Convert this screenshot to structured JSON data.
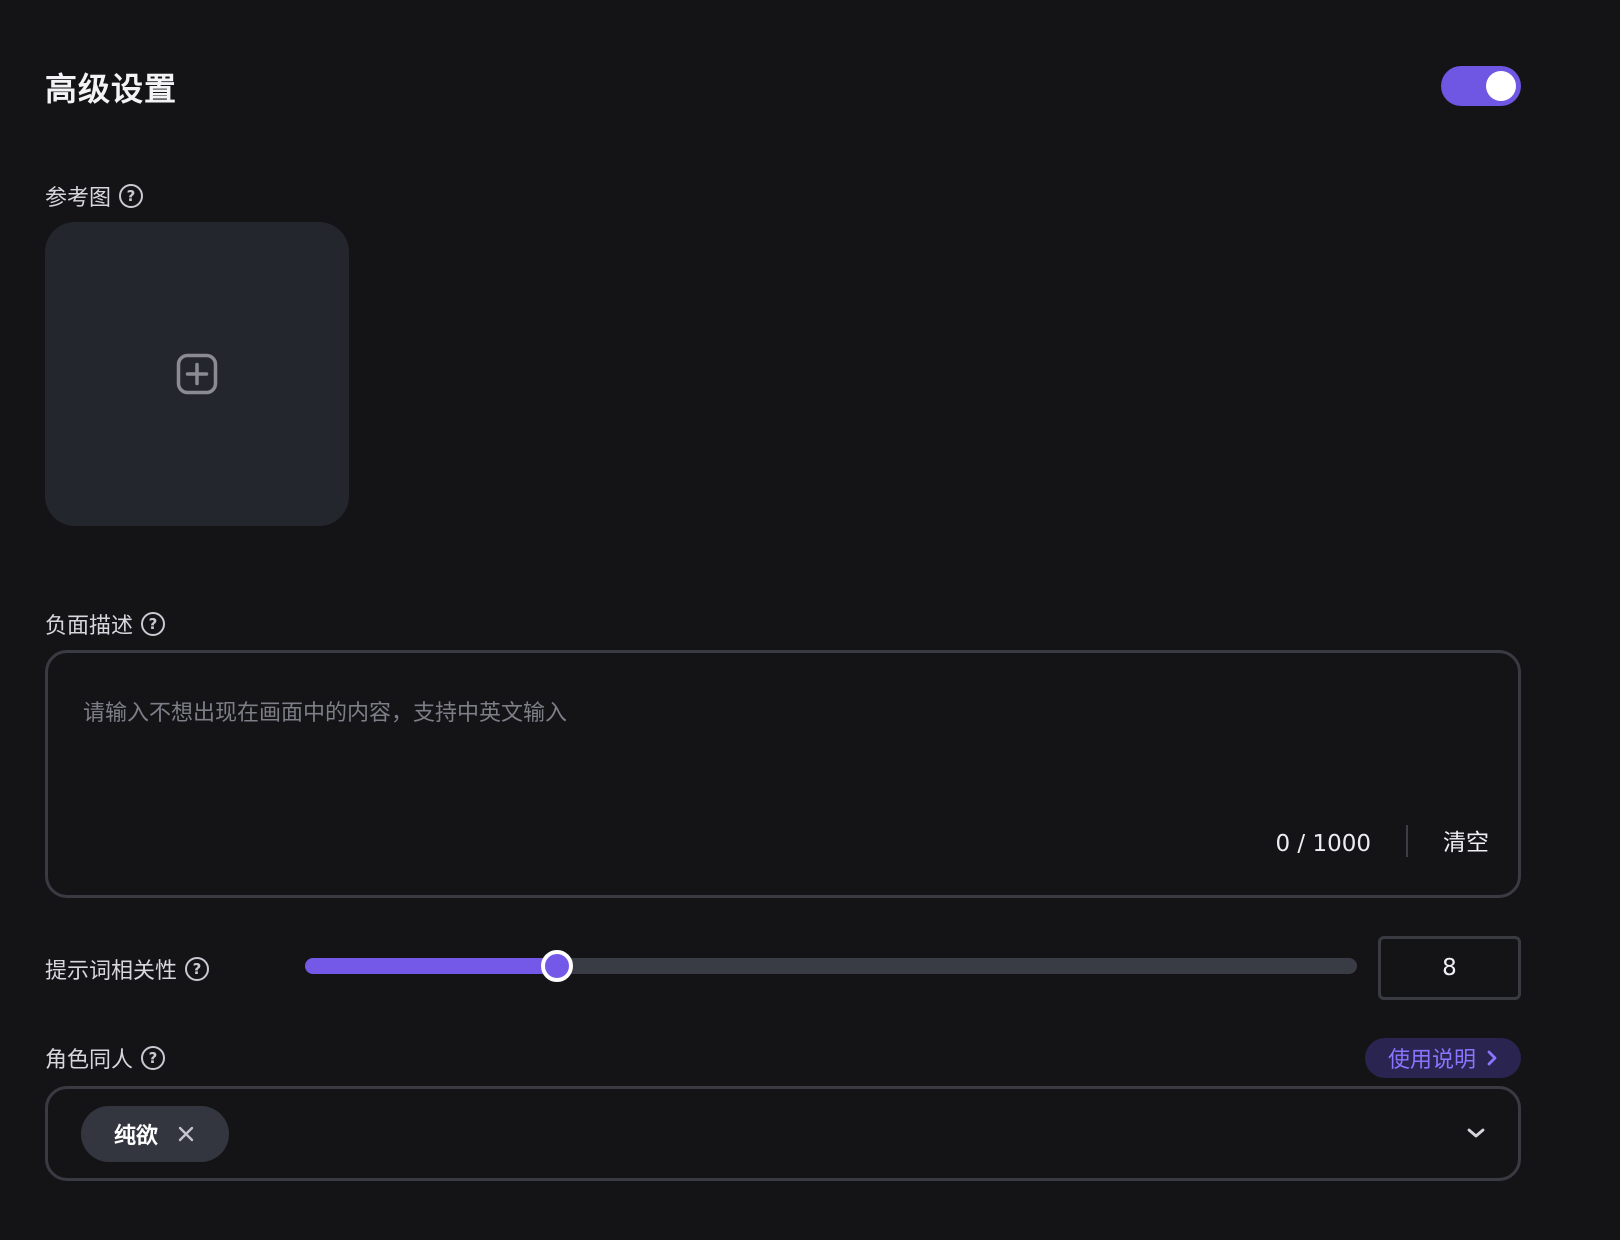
{
  "header": {
    "title": "高级设置",
    "toggle_on": true
  },
  "reference_image": {
    "label": "参考图",
    "help": "?"
  },
  "negative_prompt": {
    "label": "负面描述",
    "help": "?",
    "placeholder": "请输入不想出现在画面中的内容，支持中英文输入",
    "counter": "0 / 1000",
    "clear_label": "清空"
  },
  "relevance": {
    "label": "提示词相关性",
    "help": "?",
    "value": "8",
    "fill_fraction": 0.24
  },
  "character": {
    "label": "角色同人",
    "help": "?",
    "usage_link": "使用说明",
    "selected_tags": [
      "纯欲"
    ]
  },
  "colors": {
    "accent": "#7458e8",
    "background": "#141417",
    "panel": "#24262d",
    "link_bg": "#2a2450",
    "link_text": "#8b74ff"
  },
  "icons": {
    "help": "question-circle-icon",
    "upload": "plus-square-icon",
    "remove_tag": "close-icon",
    "dropdown": "chevron-down-icon",
    "link_arrow": "chevron-right-icon"
  }
}
